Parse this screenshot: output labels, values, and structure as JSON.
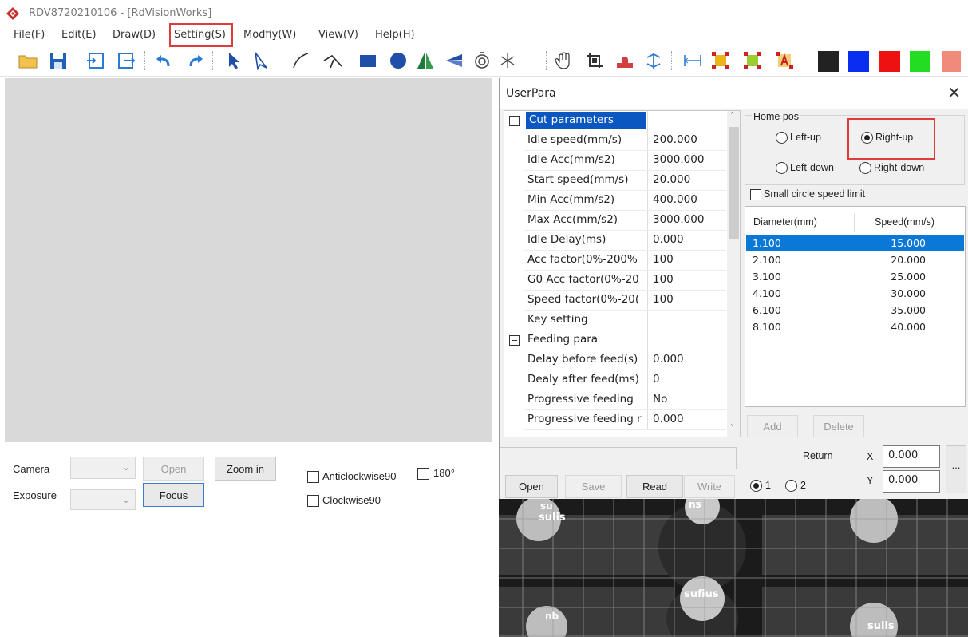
{
  "window": {
    "title": "RDV8720210106 - [RdVisionWorks]"
  },
  "menu": [
    {
      "label": "File(F)"
    },
    {
      "label": "Edit(E)"
    },
    {
      "label": "Draw(D)"
    },
    {
      "label": "Setting(S)"
    },
    {
      "label": "Modfiy(W)"
    },
    {
      "label": "View(V)"
    },
    {
      "label": "Help(H)"
    }
  ],
  "toolbar": {
    "icons": [
      "open-folder-icon",
      "save-icon",
      "import-icon",
      "export-icon",
      "undo-icon",
      "redo-icon",
      "select-arrow-icon",
      "node-edit-icon",
      "line-icon",
      "polyline-icon",
      "rectangle-icon",
      "circle-icon",
      "mirror-horizontal-icon",
      "mirror-vertical-icon",
      "rotate-icon",
      "star-icon",
      "hand-pan-icon",
      "crop-icon",
      "stamp-icon",
      "array-icon",
      "measure-icon",
      "layer-select-1-icon",
      "layer-select-2-icon",
      "layer-text-icon"
    ],
    "colors": [
      "#222222",
      "#0a2ef0",
      "#ee1111",
      "#22dd22",
      "#f08a7a"
    ]
  },
  "camera_panel": {
    "camera_label": "Camera",
    "exposure_label": "Exposure",
    "open_button": "Open",
    "zoom_in_button": "Zoom in",
    "focus_button": "Focus",
    "anticlockwise_label": "Anticlockwise90",
    "clockwise_label": "Clockwise90",
    "rotate180_label": "180°"
  },
  "dialog": {
    "title": "UserPara",
    "close": "✕",
    "cut_group": "Cut parameters",
    "cut_params": [
      {
        "name": "Idle speed(mm/s)",
        "value": "200.000"
      },
      {
        "name": "Idle Acc(mm/s2)",
        "value": "3000.000"
      },
      {
        "name": "Start speed(mm/s)",
        "value": "20.000"
      },
      {
        "name": "Min Acc(mm/s2)",
        "value": "400.000"
      },
      {
        "name": "Max Acc(mm/s2)",
        "value": "3000.000"
      },
      {
        "name": "Idle Delay(ms)",
        "value": "0.000"
      },
      {
        "name": "Acc factor(0%-200%",
        "value": "100"
      },
      {
        "name": "G0 Acc factor(0%-20",
        "value": "100"
      },
      {
        "name": "Speed factor(0%-20(",
        "value": "100"
      },
      {
        "name": "Key setting",
        "value": ""
      }
    ],
    "feed_group": "Feeding para",
    "feed_params": [
      {
        "name": "Delay before feed(s)",
        "value": "0.000"
      },
      {
        "name": "Dealy after feed(ms)",
        "value": "0"
      },
      {
        "name": "Progressive feeding",
        "value": "No"
      },
      {
        "name": "Progressive feeding r",
        "value": "0.000"
      }
    ],
    "home_pos": {
      "legend": "Home pos",
      "options": [
        "Left-up",
        "Right-up",
        "Left-down",
        "Right-down"
      ],
      "selected": "Right-up"
    },
    "small_circle_label": "Small circle speed limit",
    "table": {
      "headers": [
        "Diameter(mm)",
        "Speed(mm/s)"
      ],
      "rows": [
        [
          "1.100",
          "15.000"
        ],
        [
          "2.100",
          "20.000"
        ],
        [
          "3.100",
          "25.000"
        ],
        [
          "4.100",
          "30.000"
        ],
        [
          "6.100",
          "35.000"
        ],
        [
          "8.100",
          "40.000"
        ]
      ]
    },
    "add_button": "Add",
    "delete_button": "Delete",
    "return_label": "Return",
    "x_label": "X",
    "y_label": "Y",
    "x_value": "0.000",
    "y_value": "0.000",
    "more_button": "...",
    "open_button": "Open",
    "save_button": "Save",
    "read_button": "Read",
    "write_button": "Write",
    "radio_1": "1",
    "radio_2": "2",
    "image_text": [
      "su",
      "sulis",
      "ns",
      "sufius",
      "nb",
      "sulis"
    ]
  }
}
